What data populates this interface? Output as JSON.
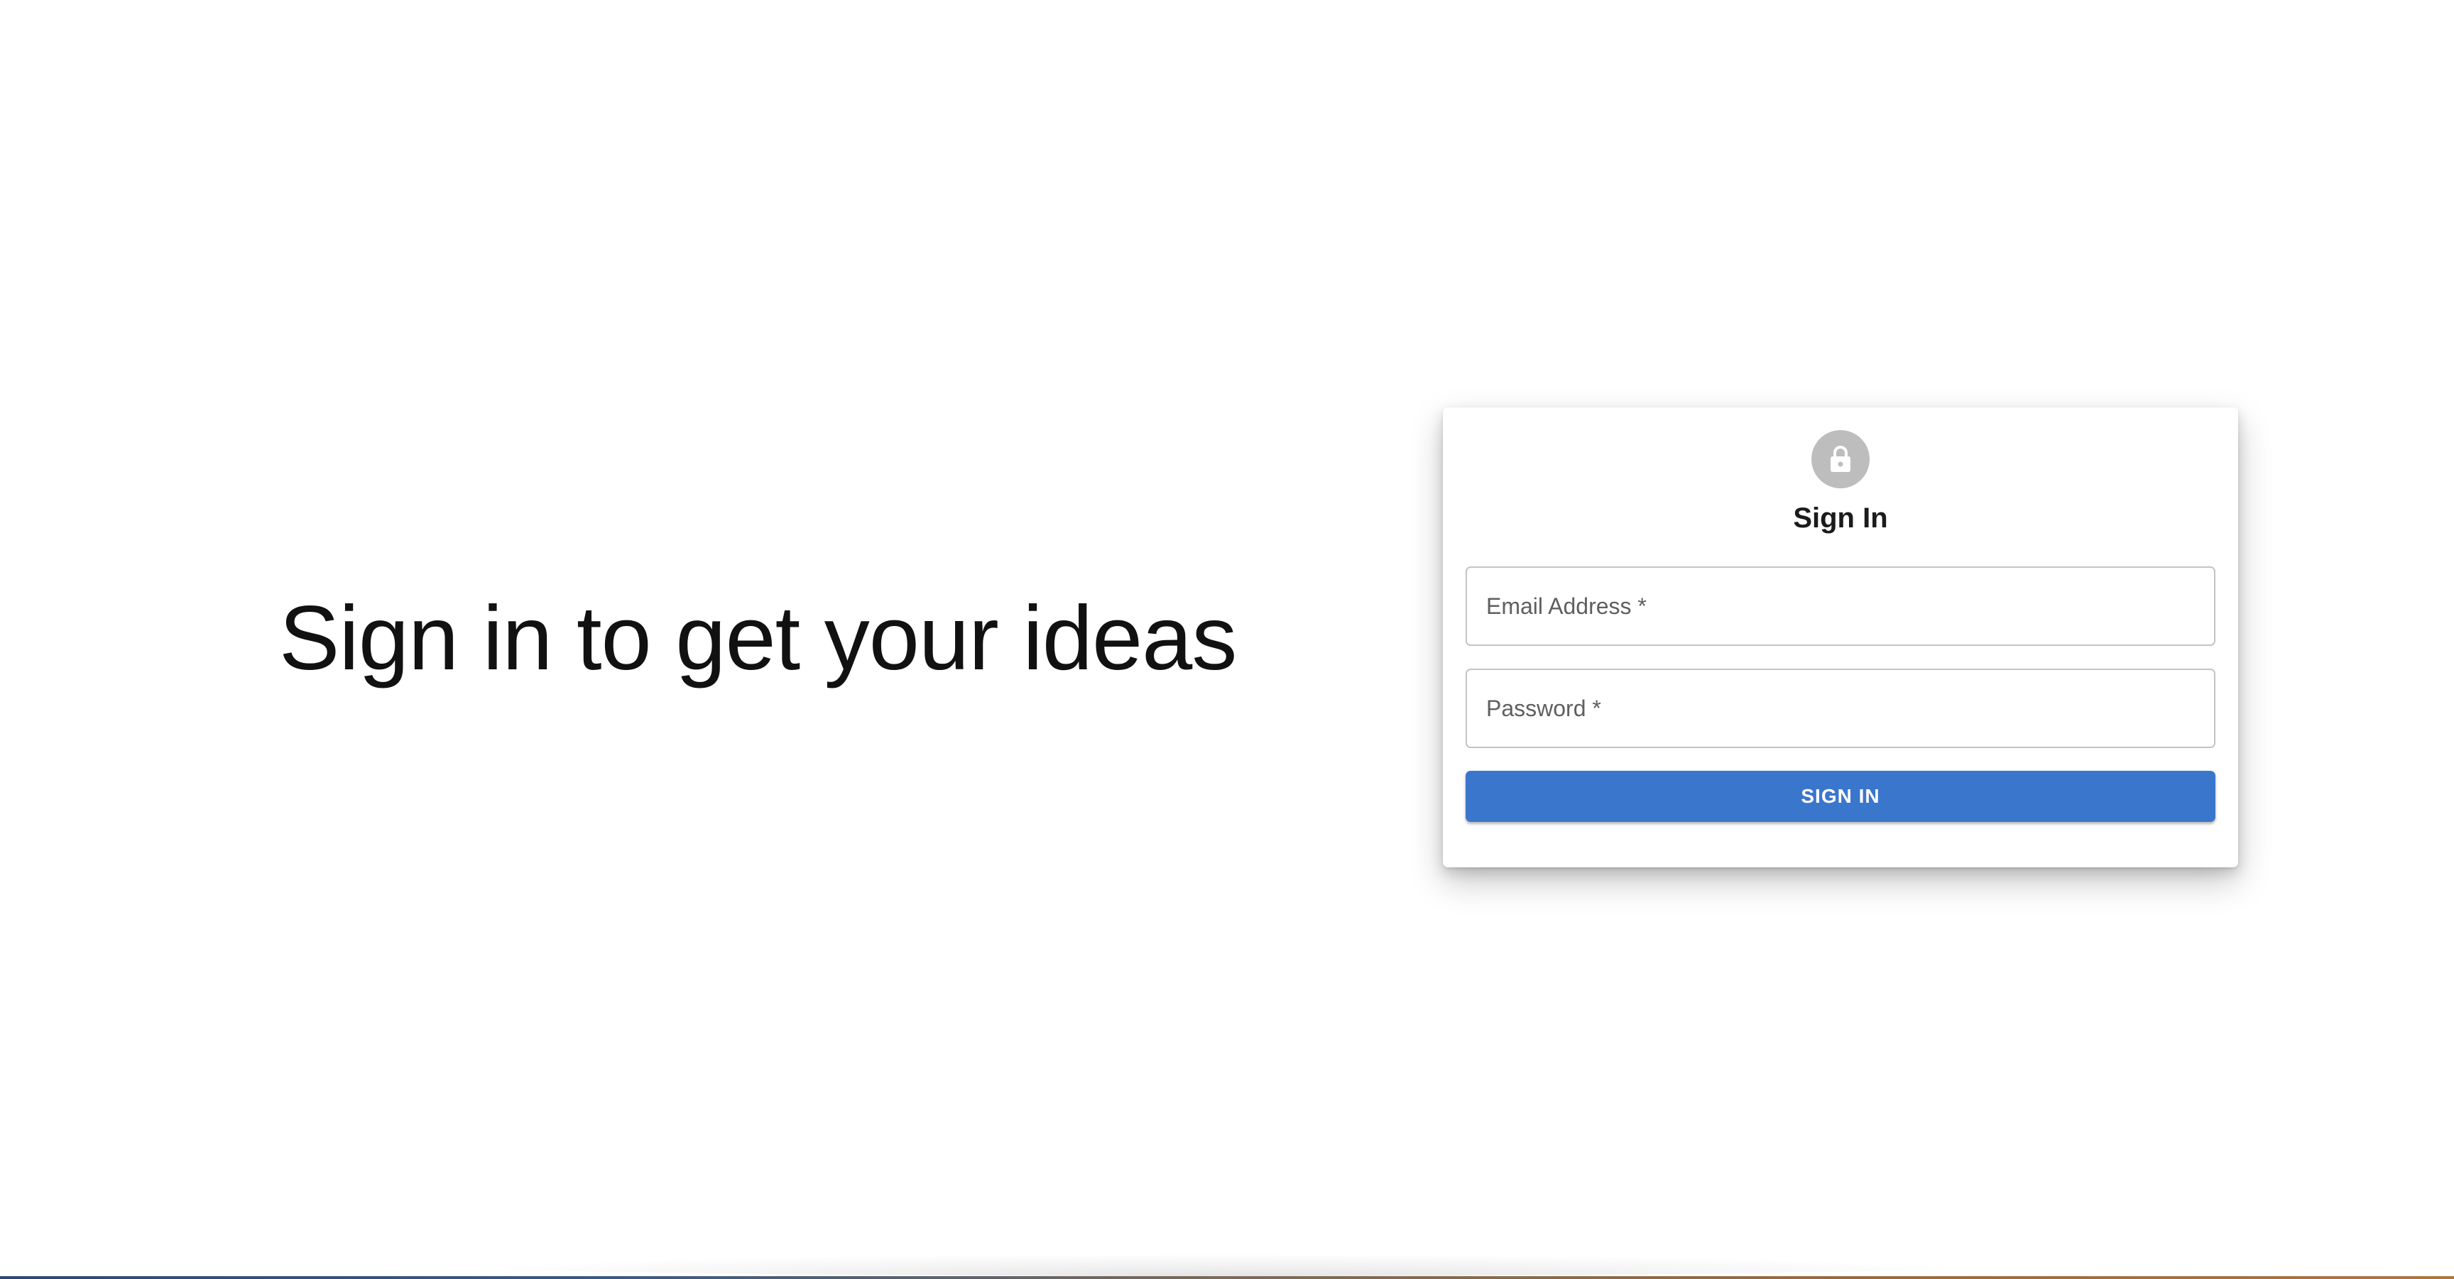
{
  "hero": {
    "heading": "Sign in to get your ideas"
  },
  "signin_card": {
    "icon": "lock-icon",
    "title": "Sign In",
    "email_field": {
      "label": "Email Address *",
      "value": ""
    },
    "password_field": {
      "label": "Password *",
      "value": ""
    },
    "submit_label": "SIGN IN"
  },
  "colors": {
    "primary": "#3b76cd",
    "avatar_background": "#bdbdbd",
    "field_border": "#c4c4c4",
    "label_text": "#5f5f5f",
    "heading_text": "#111111"
  }
}
